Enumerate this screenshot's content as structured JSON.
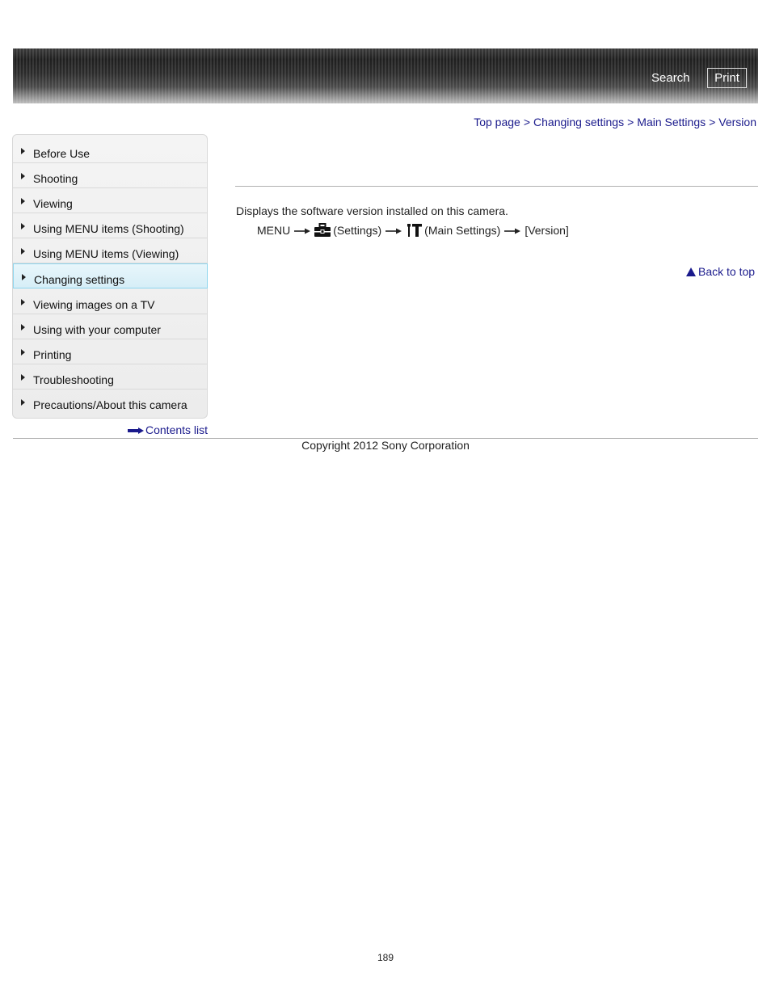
{
  "header": {
    "search_label": "Search",
    "print_label": "Print"
  },
  "breadcrumb": {
    "items": [
      "Top page",
      "Changing settings",
      "Main Settings",
      "Version"
    ],
    "separator": ">"
  },
  "sidebar": {
    "items": [
      {
        "label": "Before Use"
      },
      {
        "label": "Shooting"
      },
      {
        "label": "Viewing"
      },
      {
        "label": "Using MENU items (Shooting)"
      },
      {
        "label": "Using MENU items (Viewing)"
      },
      {
        "label": "Changing settings",
        "active": true
      },
      {
        "label": "Viewing images on a TV"
      },
      {
        "label": "Using with your computer"
      },
      {
        "label": "Printing"
      },
      {
        "label": "Troubleshooting"
      },
      {
        "label": "Precautions/About this camera"
      }
    ],
    "contents_list_label": "Contents list"
  },
  "main": {
    "description": "Displays the software version installed on this camera.",
    "menu_path": {
      "step1": "MENU",
      "step2": "(Settings)",
      "step3": "(Main Settings)",
      "step4": "[Version]",
      "icons": [
        "toolbox-icon",
        "wrench-screwdriver-icon"
      ]
    },
    "back_to_top_label": "Back to top"
  },
  "footer": {
    "copyright": "Copyright 2012 Sony Corporation",
    "page_number": "189"
  },
  "colors": {
    "link": "#1a1a8c",
    "active_highlight": "#d6eef7",
    "active_border": "#8ed6ee"
  }
}
